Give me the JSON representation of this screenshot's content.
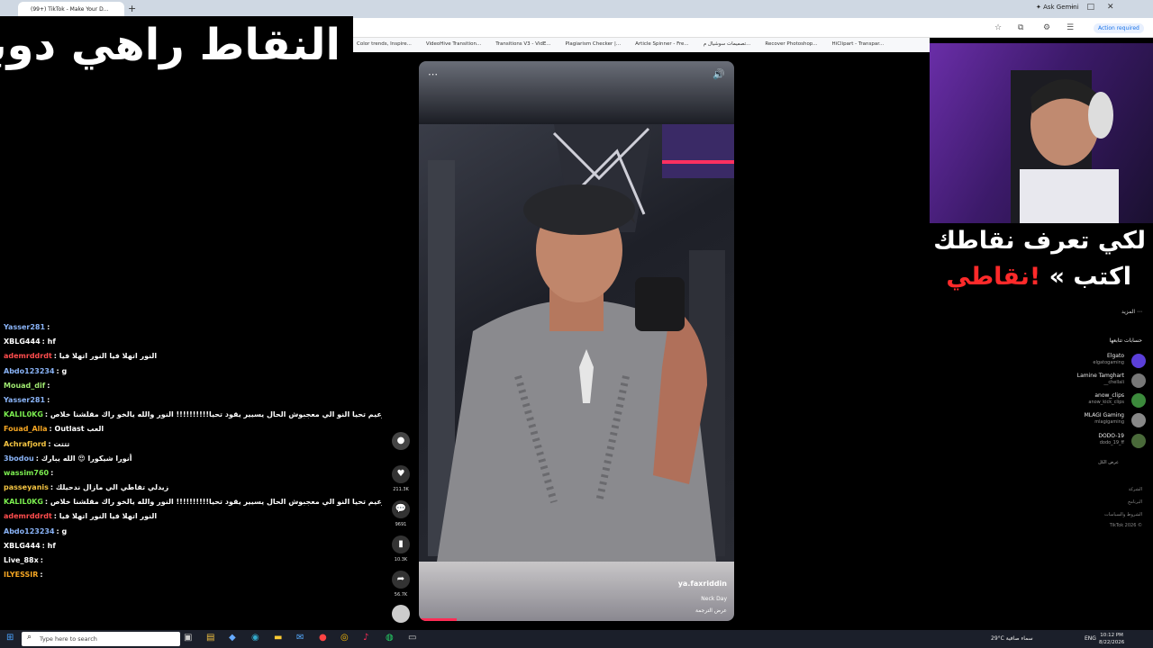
{
  "browser": {
    "tab_title": "(99+) TikTok - Make Your D...",
    "ask_gemini": "Ask Gemini",
    "action_required": "Action required",
    "bookmarks": [
      "Color trends, Inspire...",
      "VideoHive Transition...",
      "Transitions V3 - VidE...",
      "Plagiarism Checker |...",
      "Article Spinner - Fre...",
      "تصميمات سوشيال م...",
      "Recover Photoshop...",
      "HiClipart - Transpar..."
    ]
  },
  "stream_title": "النقاط راهي دوبل",
  "overlay": {
    "line1": "لكي تعرف نقاطك",
    "line2_prefix": "اكتب »",
    "line2_keyword": "!نقاطي"
  },
  "video": {
    "username": "ya.faxriddin",
    "description": "Neck Day",
    "translate": "عرض الترجمة",
    "likes": "211.3K",
    "comments": "9691",
    "saves": "10.3K",
    "shares": "56.7K",
    "progress": 0.12
  },
  "sidebar": {
    "more": "المزيد",
    "following_title": "حسابات تتابعها",
    "accounts": [
      {
        "name": "Elgato",
        "handle": "elgatogaming"
      },
      {
        "name": "Lamine Tamghart",
        "handle": "__chellali"
      },
      {
        "name": "anow_clips",
        "handle": "anow_kick_clips"
      },
      {
        "name": "MLAGI Gaming",
        "handle": "mlagigaming"
      },
      {
        "name": "DODO-19",
        "handle": "dodo_19_ff"
      }
    ],
    "show_all": "عرض الكل",
    "footer": [
      "الشركة",
      "البرنامج",
      "الشروط والسياسات",
      "TikTok 2026 ©"
    ]
  },
  "chat": [
    {
      "user": "Yasser281",
      "color": "#8ab4f8",
      "text": ":"
    },
    {
      "user": "XBLG444",
      "color": "#ffffff",
      "text": ": hf"
    },
    {
      "user": "ademrddrdt",
      "color": "#ff4d4d",
      "text": ": النور اتهلا فيا النور اتهلا فيا"
    },
    {
      "user": "Abdo123234",
      "color": "#8ab4f8",
      "text": ": g"
    },
    {
      "user": "Mouad_dif",
      "color": "#9fe870",
      "text": ":"
    },
    {
      "user": "Yasser281",
      "color": "#8ab4f8",
      "text": ":"
    },
    {
      "user": "KALIL0KG",
      "color": "#7bed4f",
      "text": ": كور الزعيم تحيا النو الي معجبوش الحال يسيير يقود تحيا!!!!!!!!!! النور والله يالخو راك مقلشنا خلاص"
    },
    {
      "user": "Fouad_Alla",
      "color": "#f5a623",
      "text": ": Outlast العب"
    },
    {
      "user": "Achrafjord",
      "color": "#f5c542",
      "text": ": تتتت"
    },
    {
      "user": "3bodou",
      "color": "#8ab4f8",
      "text": ": أنورا شيكورا 😍 الله يبارك"
    },
    {
      "user": "wassim760",
      "color": "#7bed4f",
      "text": ":"
    },
    {
      "user": "passeyanis",
      "color": "#f5c542",
      "text": ": زيدلي تقاطي الي مازال ندحيلك"
    },
    {
      "user": "KALIL0KG",
      "color": "#7bed4f",
      "text": ": كور الزعيم تحيا النو الي معجبوش الحال يسيير يقود تحيا!!!!!!!!!! النور والله يالخو راك مقلشنا خلاص"
    },
    {
      "user": "ademrddrdt",
      "color": "#ff4d4d",
      "text": ": النور اتهلا فيا النور اتهلا فيا"
    },
    {
      "user": "Abdo123234",
      "color": "#8ab4f8",
      "text": ": g"
    },
    {
      "user": "XBLG444",
      "color": "#ffffff",
      "text": ": hf"
    },
    {
      "user": "Live_88x",
      "color": "#ffffff",
      "text": ":"
    },
    {
      "user": "ILYESSIR",
      "color": "#f5a623",
      "text": ":"
    }
  ],
  "taskbar": {
    "search_placeholder": "Type here to search",
    "weather": "29°C  سماء صافية",
    "lang": "ENG",
    "time": "10:12 PM",
    "date": "8/22/2026"
  }
}
